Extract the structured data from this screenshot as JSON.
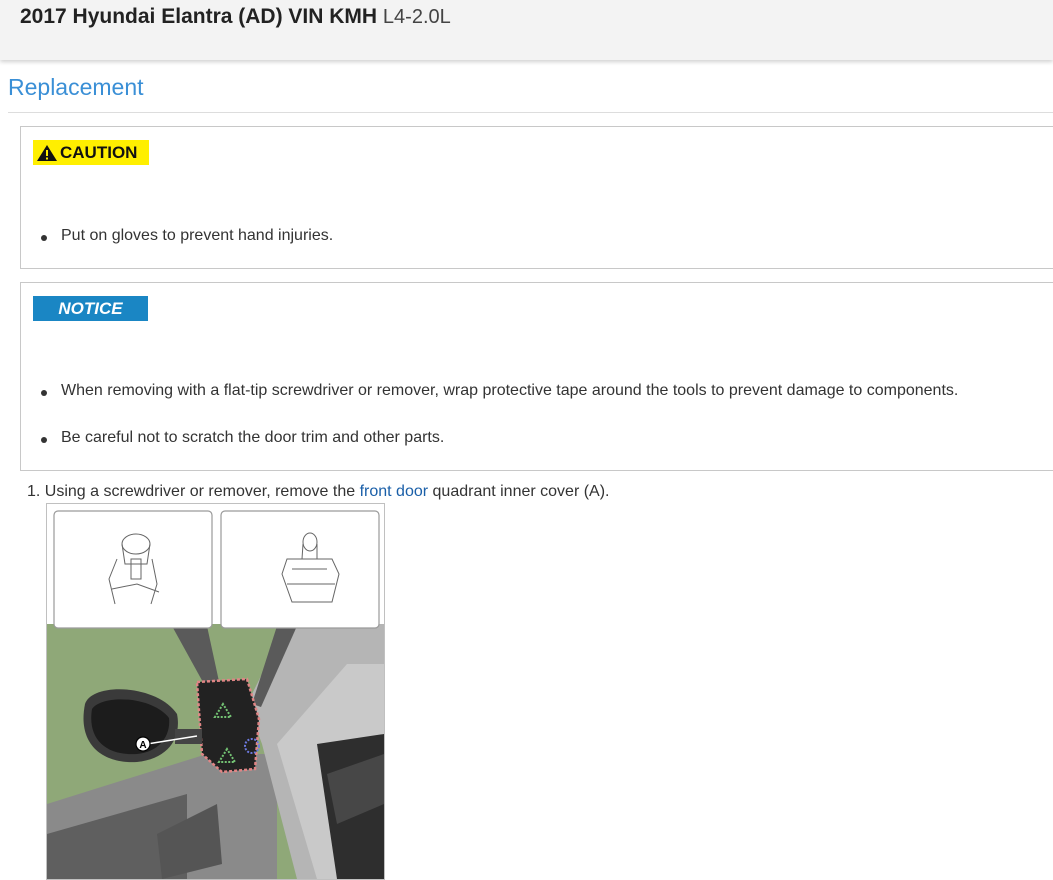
{
  "header": {
    "title": "2017 Hyundai Elantra (AD) VIN KMH",
    "engine": "L4-2.0L"
  },
  "section": {
    "title": "Replacement"
  },
  "caution": {
    "badge": "CAUTION",
    "icon": "warning-triangle-icon",
    "badge_color": "#ffef00",
    "items": [
      "Put on gloves to prevent hand injuries."
    ]
  },
  "notice": {
    "badge": "NOTICE",
    "badge_color": "#1a86c4",
    "items": [
      "When removing with a flat-tip screwdriver or remover, wrap protective tape around the tools to prevent damage to components.",
      "Be careful not to scratch the door trim and other parts."
    ]
  },
  "steps": [
    {
      "number": "1.",
      "text_before": "Using a screwdriver or remover, remove the",
      "link": "front door",
      "text_after": "quadrant inner cover (A)."
    }
  ],
  "figure": {
    "callout_label": "A"
  },
  "colors": {
    "accent": "#3a8fd6",
    "link": "#1a5fa8"
  }
}
